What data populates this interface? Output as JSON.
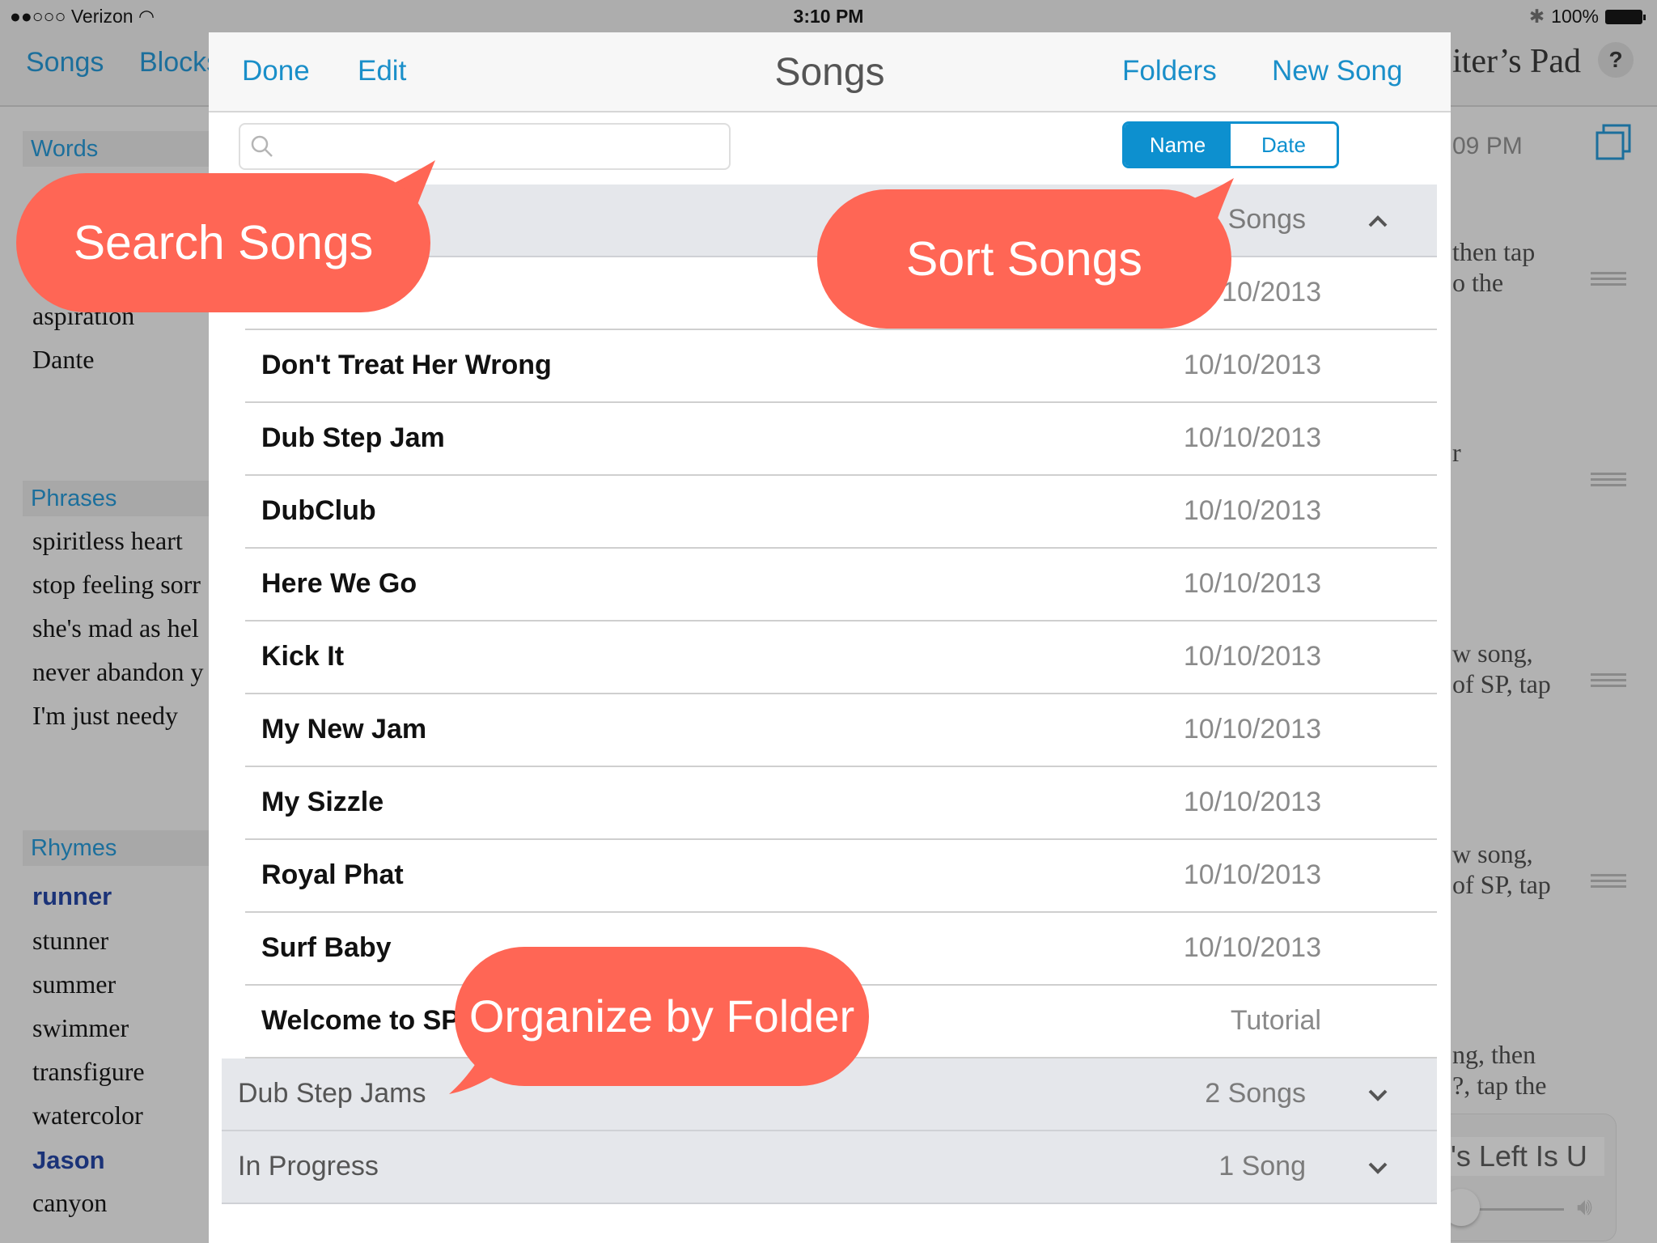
{
  "status_bar": {
    "carrier": "●●○○○ Verizon",
    "time": "3:10 PM",
    "battery": "100%"
  },
  "background_app": {
    "tabs": [
      "Songs",
      "Blocks"
    ],
    "title": "Songwriter's Pad",
    "title_visible": "iter’s Pad",
    "help_label": "?",
    "time_fragment": "09 PM",
    "sections": {
      "words": {
        "label": "Words",
        "items": [
          "aspiration",
          "Dante"
        ]
      },
      "phrases": {
        "label": "Phrases",
        "items": [
          "spiritless heart",
          "stop feeling sorr",
          "she's mad as hel",
          "never abandon y",
          "I'm just needy"
        ]
      },
      "rhymes": {
        "label": "Rhymes",
        "items": [
          "runner",
          "stunner",
          "summer",
          "swimmer",
          "transfigure",
          "watercolor",
          "Jason",
          "canyon"
        ],
        "highlighted": [
          "runner",
          "Jason"
        ]
      }
    },
    "right_snippets": [
      [
        "then tap",
        "o the"
      ],
      [
        "r"
      ],
      [
        "w song,",
        "of SP, tap"
      ],
      [
        "w song,",
        "of SP, tap"
      ],
      [
        "ng, then",
        "?, tap the"
      ]
    ],
    "player": {
      "track_title": "'s Left Is U"
    }
  },
  "modal": {
    "title": "Songs",
    "done_label": "Done",
    "edit_label": "Edit",
    "folders_label": "Folders",
    "new_song_label": "New Song",
    "search": {
      "placeholder": "",
      "value": ""
    },
    "sort": {
      "options": [
        "Name",
        "Date"
      ],
      "selected": "Name"
    },
    "open_folder": {
      "count_label": "Songs",
      "expanded": true
    },
    "songs": [
      {
        "name": "",
        "date": "10/10/2013"
      },
      {
        "name": "Don't Treat Her Wrong",
        "date": "10/10/2013"
      },
      {
        "name": "Dub Step Jam",
        "date": "10/10/2013"
      },
      {
        "name": "DubClub",
        "date": "10/10/2013"
      },
      {
        "name": "Here We Go",
        "date": "10/10/2013"
      },
      {
        "name": "Kick It",
        "date": "10/10/2013"
      },
      {
        "name": "My New Jam",
        "date": "10/10/2013"
      },
      {
        "name": "My Sizzle",
        "date": "10/10/2013"
      },
      {
        "name": "Royal Phat",
        "date": "10/10/2013"
      },
      {
        "name": "Surf Baby",
        "date": "10/10/2013"
      },
      {
        "name": "Welcome to SP",
        "date": "Tutorial"
      }
    ],
    "folders": [
      {
        "name": "Dub Step Jams",
        "count": "2 Songs",
        "expanded": false
      },
      {
        "name": "In Progress",
        "count": "1 Song",
        "expanded": false
      }
    ]
  },
  "callouts": {
    "search": "Search Songs",
    "sort": "Sort Songs",
    "folders": "Organize by Folder"
  },
  "colors": {
    "accent": "#0d90cf",
    "callout": "#ff6655",
    "folder_row": "#e5e7eb",
    "dim_background": "#b2b2b2"
  }
}
